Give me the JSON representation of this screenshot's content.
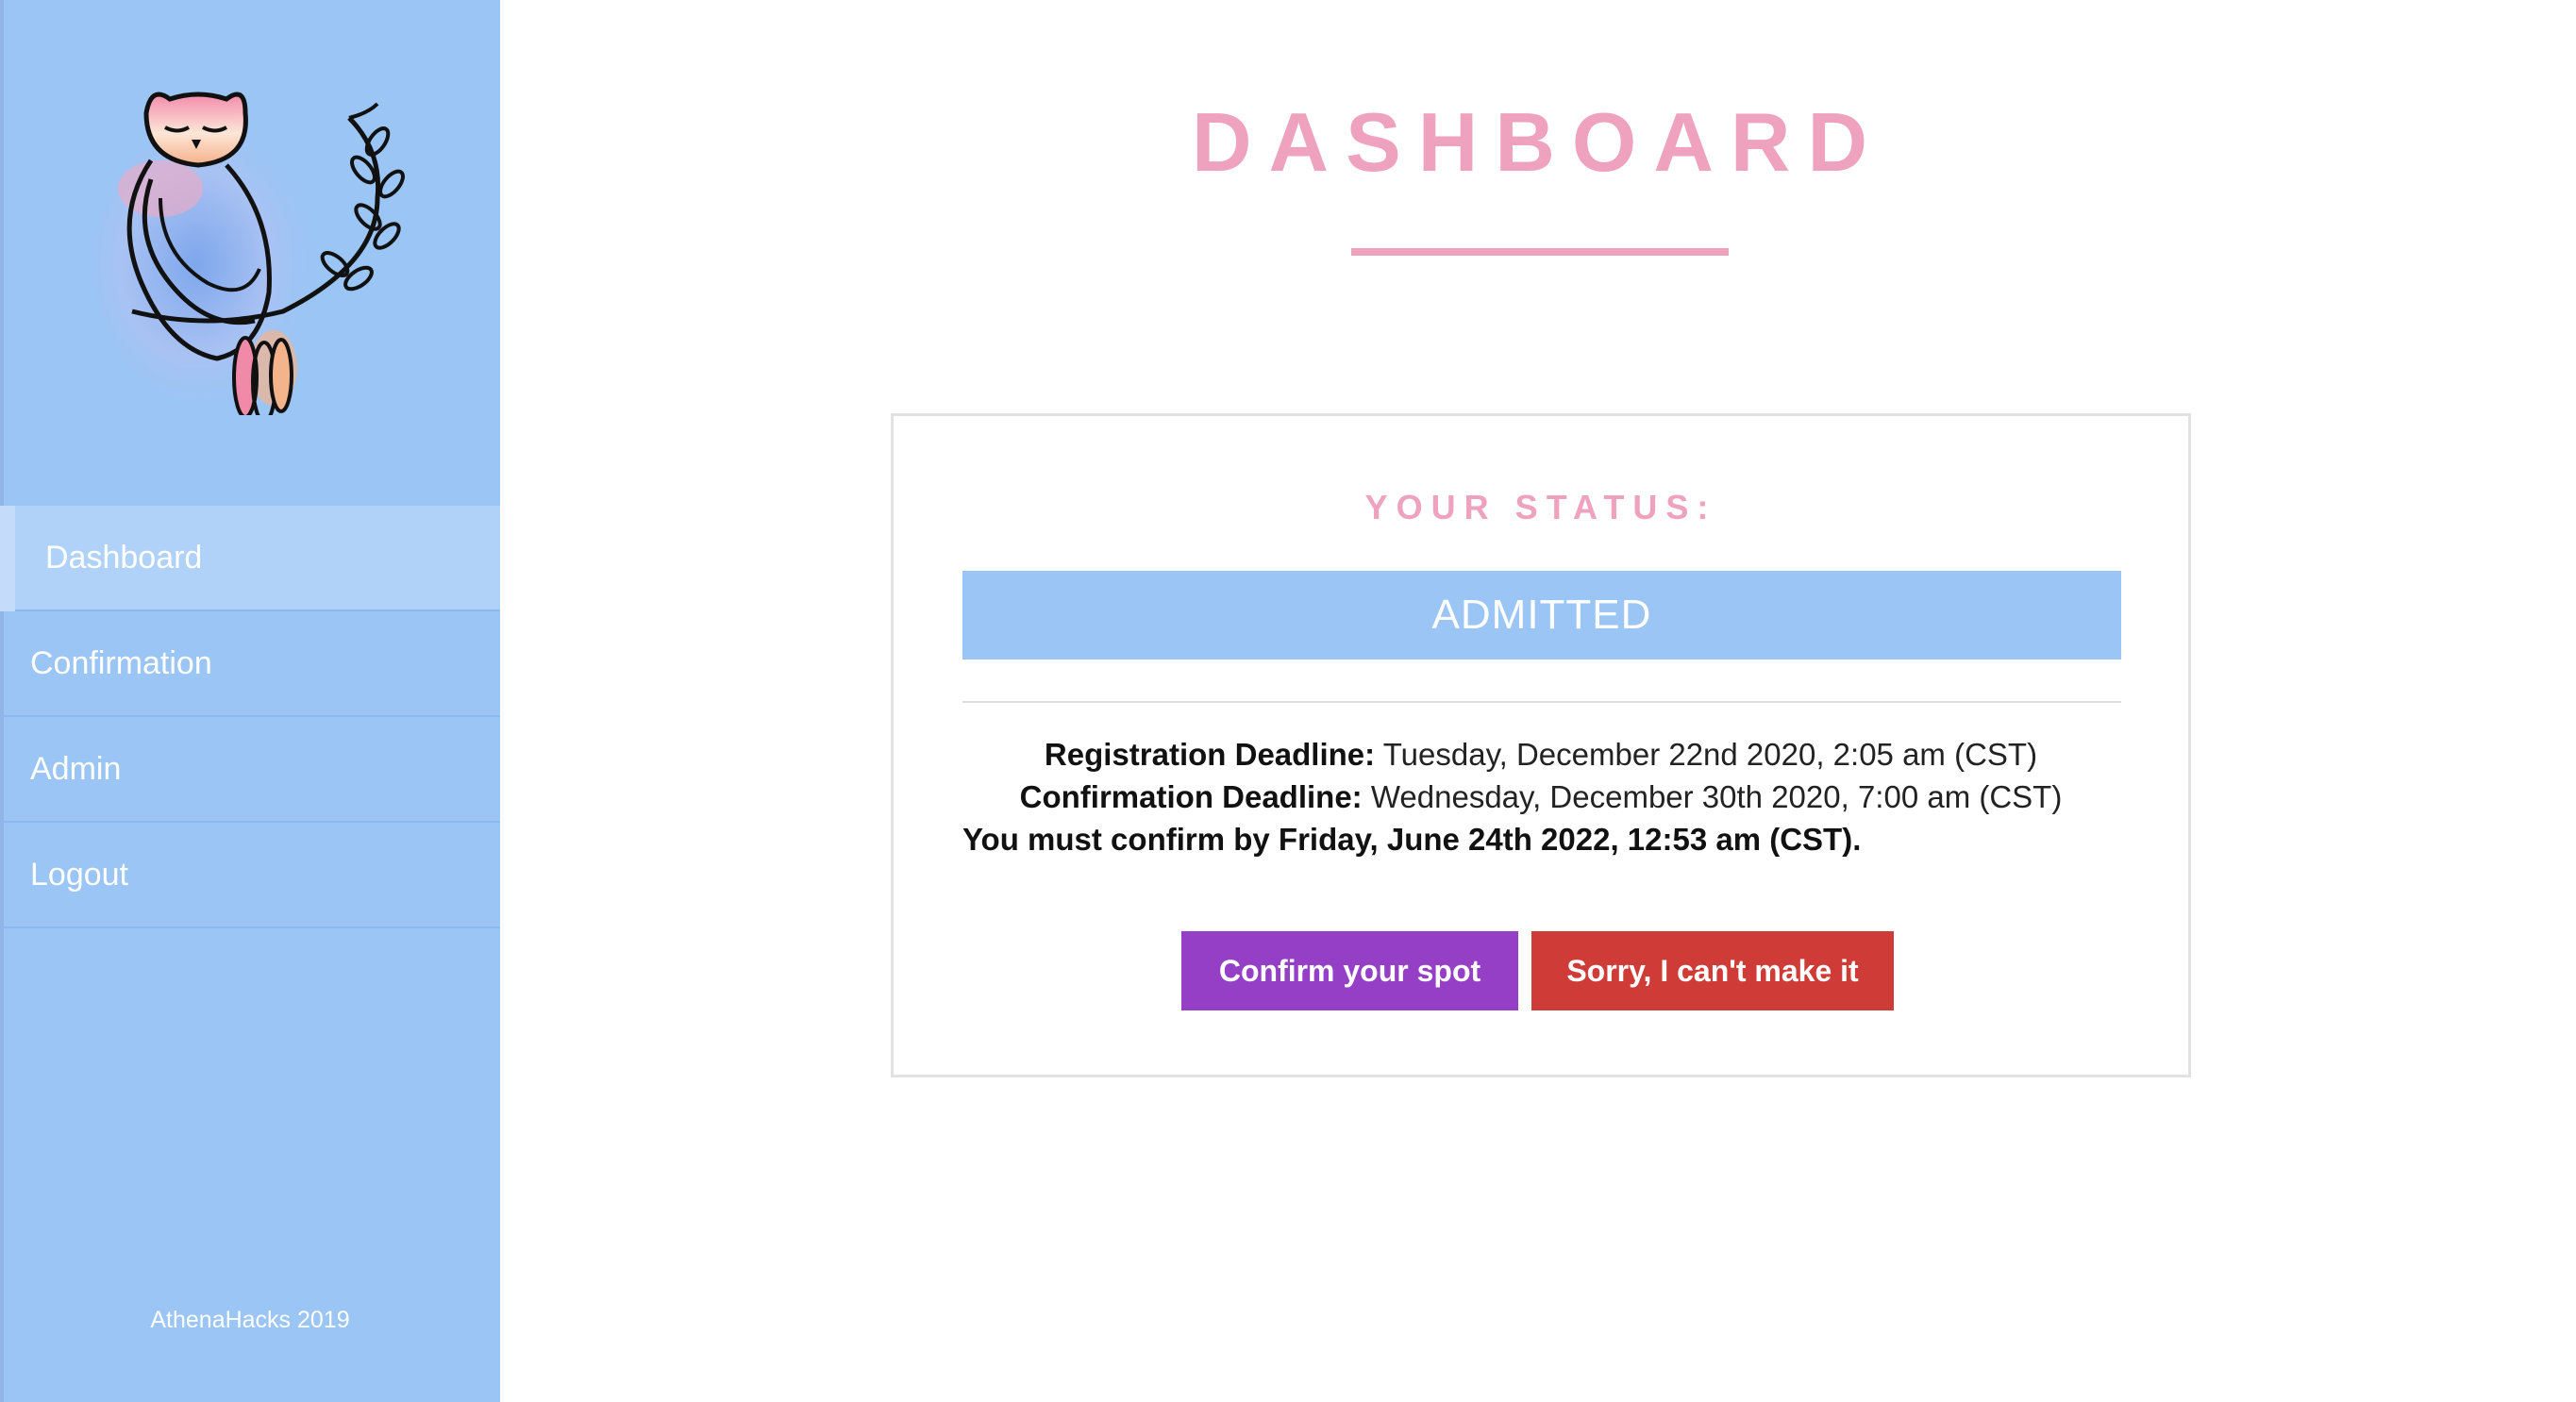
{
  "sidebar": {
    "nav": [
      {
        "label": "Dashboard"
      },
      {
        "label": "Confirmation"
      },
      {
        "label": "Admin"
      },
      {
        "label": "Logout"
      }
    ],
    "footer": "AthenaHacks 2019"
  },
  "main": {
    "title": "DASHBOARD",
    "status_label": "YOUR STATUS:",
    "status_value": "ADMITTED",
    "registration": {
      "label": "Registration Deadline:",
      "value": " Tuesday, December 22nd 2020, 2:05 am (CST)"
    },
    "confirmation": {
      "label": "Confirmation Deadline:",
      "value": " Wednesday, December 30th 2020, 7:00 am (CST)"
    },
    "must_confirm": "You must confirm by Friday, June 24th 2022, 12:53 am (CST).",
    "confirm_button": "Confirm your spot",
    "decline_button": "Sorry, I can't make it"
  },
  "colors": {
    "sidebar": "#9bc5f5",
    "accent_pink": "#eea2be",
    "confirm": "#943fc5",
    "decline": "#cf3b36"
  },
  "icons": {
    "logo": "owl-on-branch-logo"
  }
}
